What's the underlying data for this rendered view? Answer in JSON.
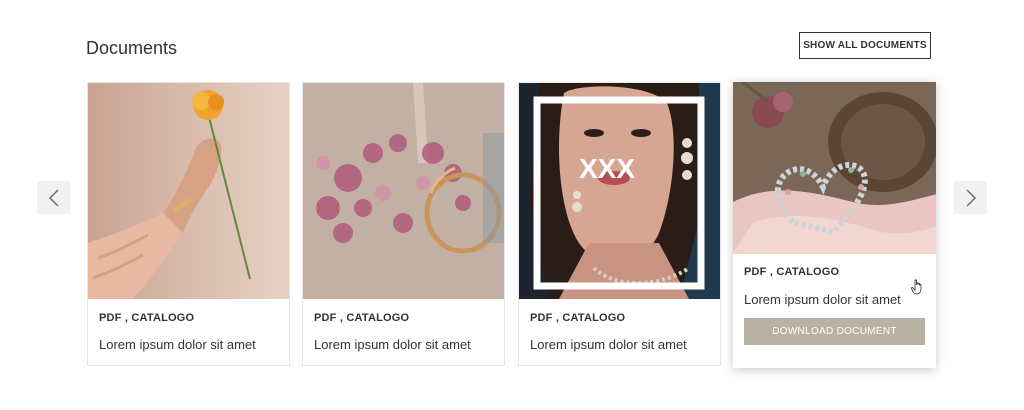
{
  "section": {
    "title": "Documents",
    "show_all_label": "SHOW ALL DOCUMENTS"
  },
  "carousel": {
    "prev_icon": "chevron-left-icon",
    "next_icon": "chevron-right-icon"
  },
  "cards": [
    {
      "meta": "PDF , CATALOGO",
      "description": "Lorem ipsum dolor sit amet"
    },
    {
      "meta": "PDF , CATALOGO",
      "description": "Lorem ipsum dolor sit amet"
    },
    {
      "meta": "PDF , CATALOGO",
      "description": "Lorem ipsum dolor sit amet",
      "image_overlay_text": "XXX"
    },
    {
      "meta": "PDF , CATALOGO",
      "description": "Lorem ipsum dolor sit amet",
      "download_label": "DOWNLOAD DOCUMENT"
    }
  ],
  "colors": {
    "accent_button": "#b9b1a3",
    "text": "#333333",
    "nav_bg": "#f1f1f1"
  }
}
